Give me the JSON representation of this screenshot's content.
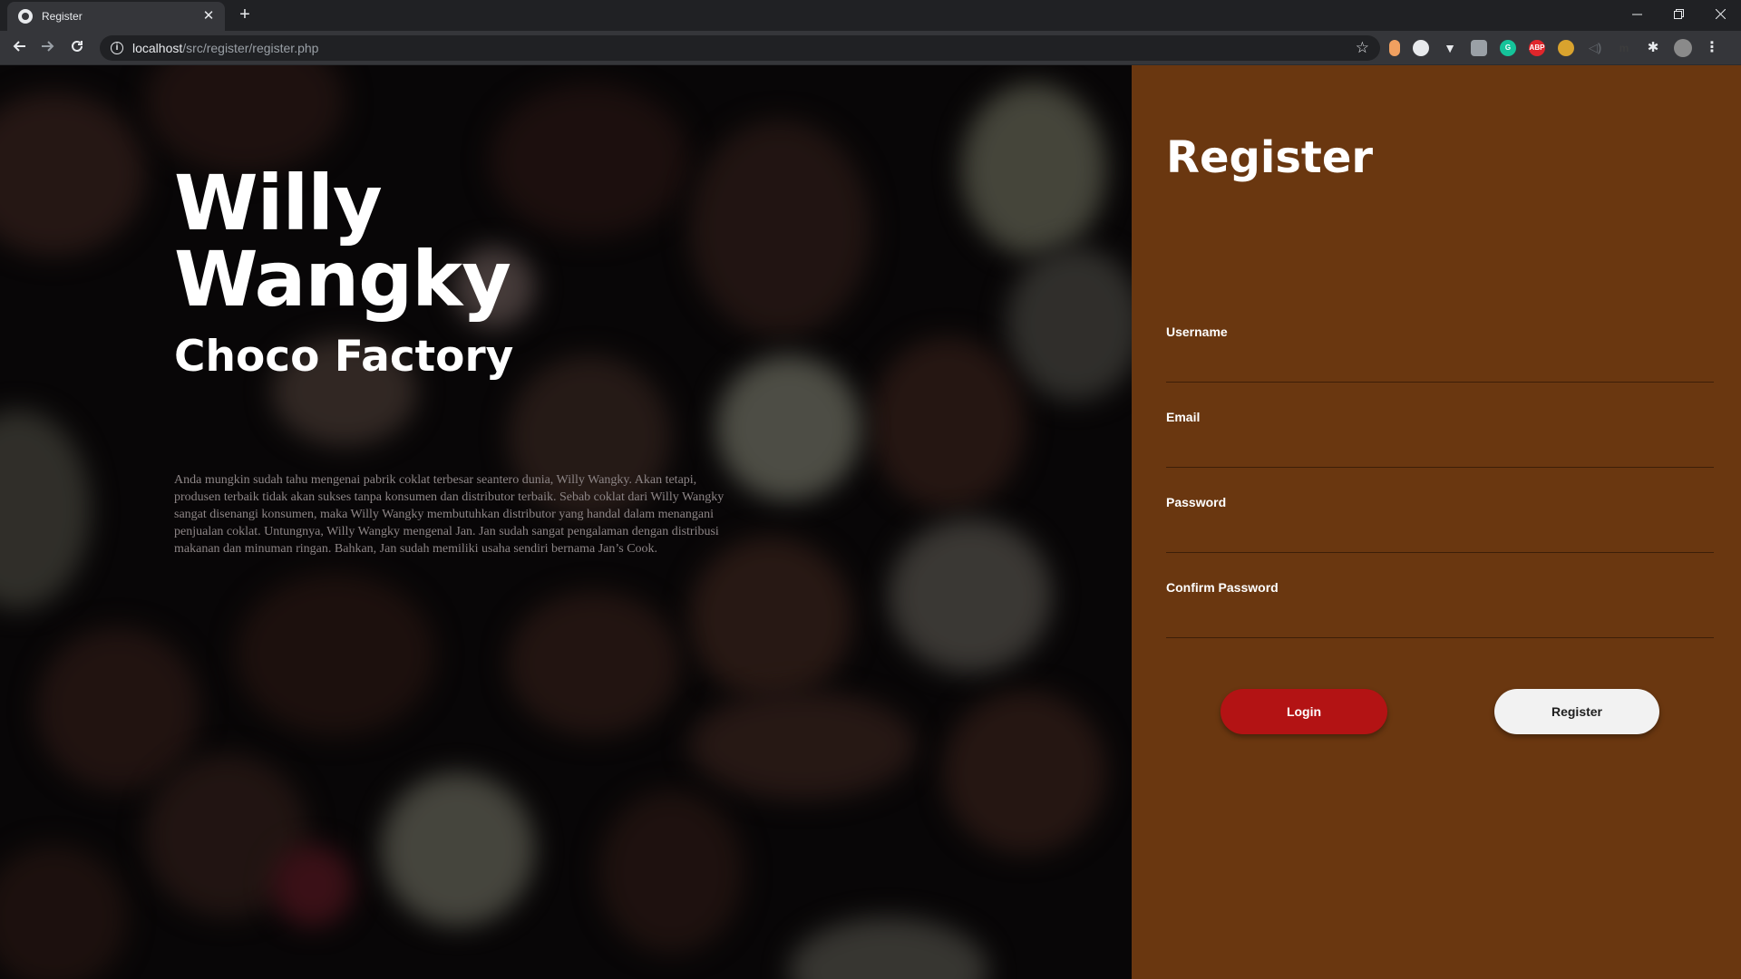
{
  "browser": {
    "tab_title": "Register",
    "new_tab_symbol": "+",
    "close_symbol": "✕",
    "url_host": "localhost",
    "url_path": "/src/register/register.php"
  },
  "hero": {
    "title": "Willy Wangky",
    "subtitle": "Choco Factory",
    "description": "Anda mungkin sudah tahu mengenai pabrik coklat terbesar seantero dunia, Willy Wangky. Akan tetapi, produsen terbaik tidak akan sukses tanpa konsumen dan distributor terbaik. Sebab coklat dari Willy Wangky sangat disenangi konsumen, maka Willy Wangky membutuhkan distributor yang handal dalam menangani penjualan coklat. Untungnya, Willy Wangky mengenal Jan. Jan sudah sangat pengalaman dengan distribusi makanan dan minuman ringan. Bahkan, Jan sudah memiliki usaha sendiri bernama Jan’s Cook."
  },
  "form": {
    "title": "Register",
    "fields": [
      {
        "label": "Username",
        "value": ""
      },
      {
        "label": "Email",
        "value": ""
      },
      {
        "label": "Password",
        "value": ""
      },
      {
        "label": "Confirm Password",
        "value": ""
      }
    ],
    "login_label": "Login",
    "register_label": "Register"
  },
  "colors": {
    "panel": "#6a3710",
    "login_button": "#b31314",
    "register_button": "#f2f2f2"
  }
}
